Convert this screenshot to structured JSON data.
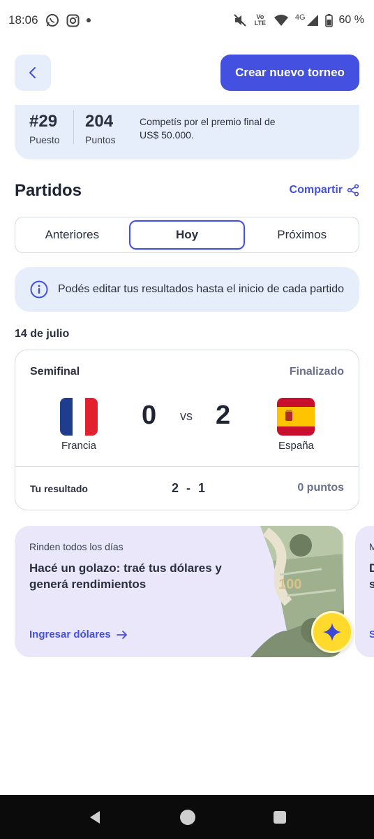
{
  "status_bar": {
    "time": "18:06",
    "battery": "60 %",
    "network": "4G",
    "volte": "Vo LTE"
  },
  "header": {
    "create_button": "Crear nuevo torneo"
  },
  "stats": {
    "rank": "#29",
    "rank_label": "Puesto",
    "points": "204",
    "points_label": "Puntos",
    "description": "Competís por el premio final de US$ 50.000."
  },
  "matches_section": {
    "title": "Partidos",
    "share_label": "Compartir",
    "tabs": [
      {
        "label": "Anteriores",
        "active": false
      },
      {
        "label": "Hoy",
        "active": true
      },
      {
        "label": "Próximos",
        "active": false
      }
    ],
    "info": "Podés editar tus resultados hasta el inicio de cada partido",
    "date": "14 de julio"
  },
  "match": {
    "stage": "Semifinal",
    "status": "Finalizado",
    "home_team": "Francia",
    "away_team": "España",
    "home_score": "0",
    "away_score": "2",
    "vs": "VS",
    "your_result_label": "Tu resultado",
    "your_result": "2 - 1",
    "points_earned": "0 puntos"
  },
  "promo": {
    "kicker": "Rinden todos los días",
    "title": "Hacé un golazo: traé tus dólares y generá rendimientos",
    "link": "Ingresar dólares"
  },
  "promo_2": {
    "kicker": "M",
    "title": "D s",
    "link": "S"
  },
  "colors": {
    "accent": "#4350e0",
    "card_bg": "#e7eefb",
    "promo_bg": "#ebe7fb",
    "muted": "#6a6f8a",
    "star_yellow": "#ffd92c"
  },
  "icons": [
    "whatsapp-icon",
    "instagram-icon",
    "mute-icon",
    "wifi-icon",
    "signal-icon",
    "battery-icon",
    "back-chevron-icon",
    "share-icon",
    "info-icon",
    "arrow-right-icon",
    "sparkle-icon",
    "nav-back-icon",
    "nav-home-icon",
    "nav-recents-icon"
  ]
}
